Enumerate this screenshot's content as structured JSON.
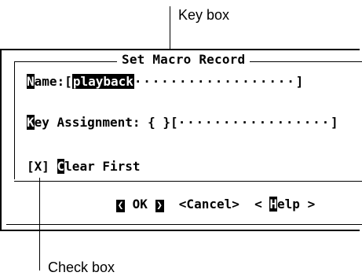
{
  "callouts": {
    "key_box": "Key box",
    "check_box": "Check box"
  },
  "dialog": {
    "title": "Set Macro Record",
    "name_label_hot": "N",
    "name_label_rest": "ame:",
    "name_open": "[",
    "name_value": "playback",
    "name_dots": "··················",
    "name_close": "]",
    "key_label_hot": "K",
    "key_label_rest": "ey Assignment: ",
    "key_box": "{ }",
    "key_open": "[",
    "key_dots": "·················",
    "key_close": "]",
    "check_state": "[X] ",
    "check_hot": "C",
    "check_rest": "lear First",
    "ok_label": " OK ",
    "cancel_label": "<Cancel>",
    "help_open": "< ",
    "help_hot": "H",
    "help_rest": "elp >"
  },
  "icons": {
    "left_arrow": "❮",
    "right_arrow": "❯"
  }
}
